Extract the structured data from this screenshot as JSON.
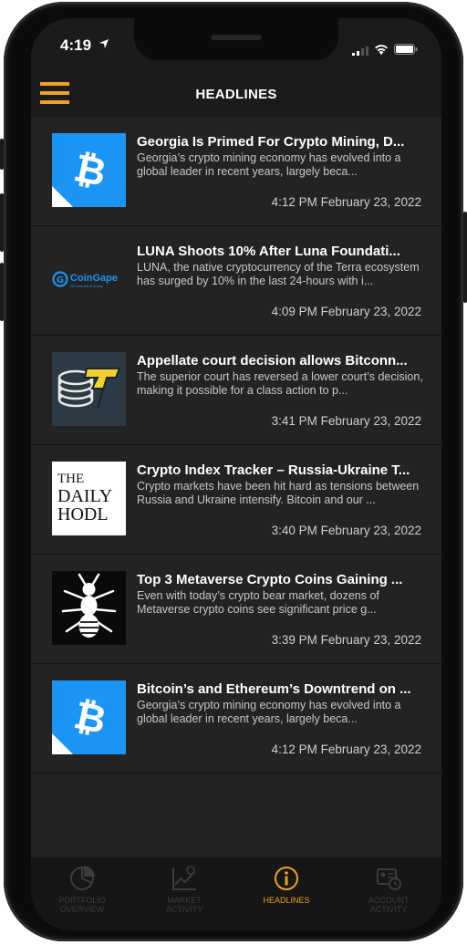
{
  "status_bar": {
    "time": "4:19"
  },
  "header": {
    "title": "HEADLINES",
    "menu_icon": "hamburger-menu-icon"
  },
  "colors": {
    "accent": "#f0a220",
    "background": "#232323",
    "bitcoin_blue": "#1b95f5"
  },
  "articles": [
    {
      "headline": "Georgia Is Primed For Crypto Mining, D...",
      "excerpt": "Georgia’s crypto mining economy has evolved into a global leader in recent years, largely beca...",
      "date": "4:12 PM February 23, 2022",
      "thumbnail": "bitcoin-logo"
    },
    {
      "headline": "LUNA Shoots 10% After Luna Foundati...",
      "excerpt": "LUNA, the native cryptocurrency of the Terra ecosystem has surged by 10% in the last 24-hours with i...",
      "date": "4:09 PM February 23, 2022",
      "thumbnail": "coingape-logo",
      "thumbnail_text": "CoinGape",
      "thumbnail_subtext": "The best test of money"
    },
    {
      "headline": "Appellate court decision allows Bitconn...",
      "excerpt": "The superior court has reversed a lower court’s decision, making it possible for a class action to p...",
      "date": "3:41 PM February 23, 2022",
      "thumbnail": "cointelegraph-logo"
    },
    {
      "headline": "Crypto Index Tracker – Russia-Ukraine T...",
      "excerpt": "Crypto markets have been hit hard as tensions between Russia and Ukraine intensify. Bitcoin and our ...",
      "date": "3:40 PM February 23, 2022",
      "thumbnail": "daily-hodl-logo",
      "thumbnail_lines": [
        "THE",
        "DAILY",
        "HODL"
      ]
    },
    {
      "headline": "Top 3 Metaverse Crypto Coins Gaining ...",
      "excerpt": "Even with today’s crypto bear market, dozens of Metaverse crypto coins see significant price g...",
      "date": "3:39 PM February 23, 2022",
      "thumbnail": "ant-logo"
    },
    {
      "headline": "Bitcoin’s and Ethereum’s Downtrend on ...",
      "excerpt": "Georgia’s crypto mining economy has evolved into a global leader in recent years, largely beca...",
      "date": "4:12 PM February 23, 2022",
      "thumbnail": "bitcoin-logo"
    }
  ],
  "tabs": [
    {
      "label_line1": "PORTFOLIO",
      "label_line2": "OVERVIEW",
      "icon": "pie-chart-icon",
      "active": false
    },
    {
      "label_line1": "MARKET",
      "label_line2": "ACTIVITY",
      "icon": "market-chart-icon",
      "active": false
    },
    {
      "label_line1": "HEADLINES",
      "label_line2": "",
      "icon": "info-icon",
      "active": true
    },
    {
      "label_line1": "ACCOUNT",
      "label_line2": "ACTIVITY",
      "icon": "account-activity-icon",
      "active": false
    }
  ]
}
